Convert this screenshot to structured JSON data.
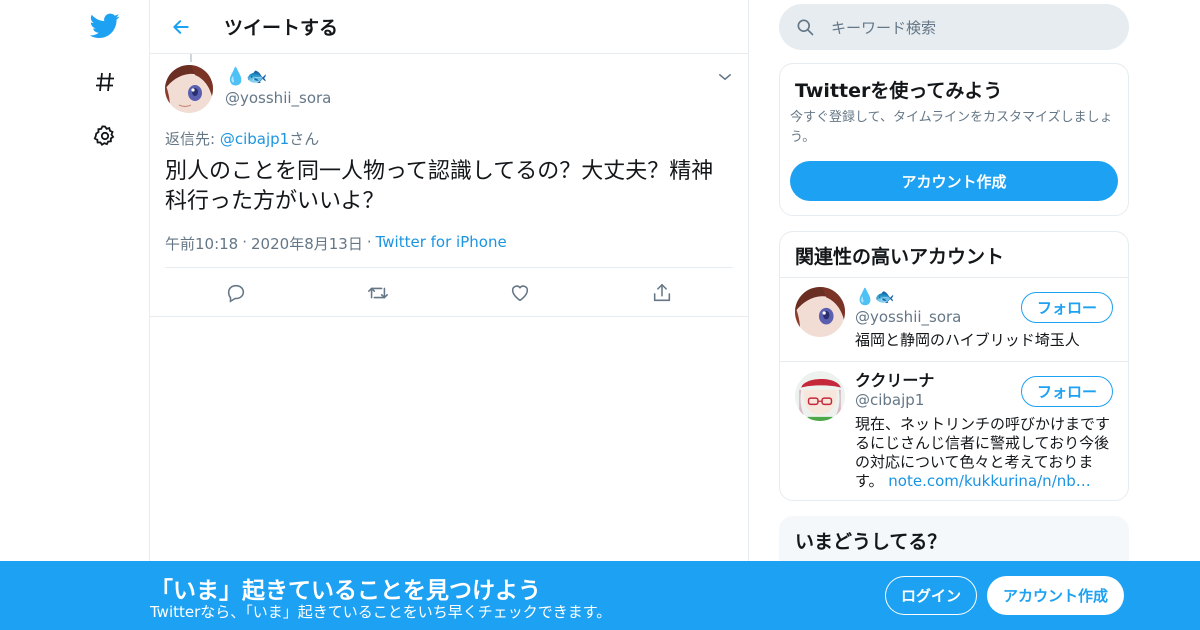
{
  "colors": {
    "brand": "#1da1f2",
    "link": "#1b95e0",
    "muted": "#657786",
    "border": "#e6ecf0"
  },
  "nav": {
    "icons": [
      "twitter-bird-icon",
      "hashtag-icon",
      "gear-icon"
    ]
  },
  "header": {
    "back_icon": "arrow-left-icon",
    "title": "ツイートする"
  },
  "tweet": {
    "display_name": "💧🐟",
    "handle": "@yosshii_sora",
    "reply_prefix": "返信先: ",
    "reply_handle": "@cibajp1",
    "reply_suffix": "さん",
    "text": "別人のことを同一人物って認識してるの？大丈夫？精神科行った方がいいよ？",
    "time": "午前10:18",
    "date": "2020年8月13日",
    "source": "Twitter for iPhone",
    "actions": [
      "reply-icon",
      "retweet-icon",
      "like-icon",
      "share-icon"
    ]
  },
  "search": {
    "placeholder": "キーワード検索"
  },
  "try_card": {
    "title": "Twitterを使ってみよう",
    "desc": "今すぐ登録して、タイムラインをカスタマイズしましょう。",
    "button": "アカウント作成"
  },
  "related": {
    "title": "関連性の高いアカウント",
    "accounts": [
      {
        "name": "💧🐟",
        "handle": "@yosshii_sora",
        "bio": "福岡と静岡のハイブリッド埼玉人",
        "follow": "フォロー"
      },
      {
        "name": "ククリーナ",
        "handle": "@cibajp1",
        "bio": "現在、ネットリンチの呼びかけまでするにじさんじ信者に警戒しており今後の対応について色々と考えております。",
        "link": "note.com/kukkurina/n/nb…",
        "follow": "フォロー"
      }
    ]
  },
  "now_card": {
    "title": "いまどうしてる？"
  },
  "banner": {
    "title": "「いま」起きていることを見つけよう",
    "subtitle": "Twitterなら、「いま」起きていることをいち早くチェックできます。",
    "login": "ログイン",
    "signup": "アカウント作成"
  }
}
